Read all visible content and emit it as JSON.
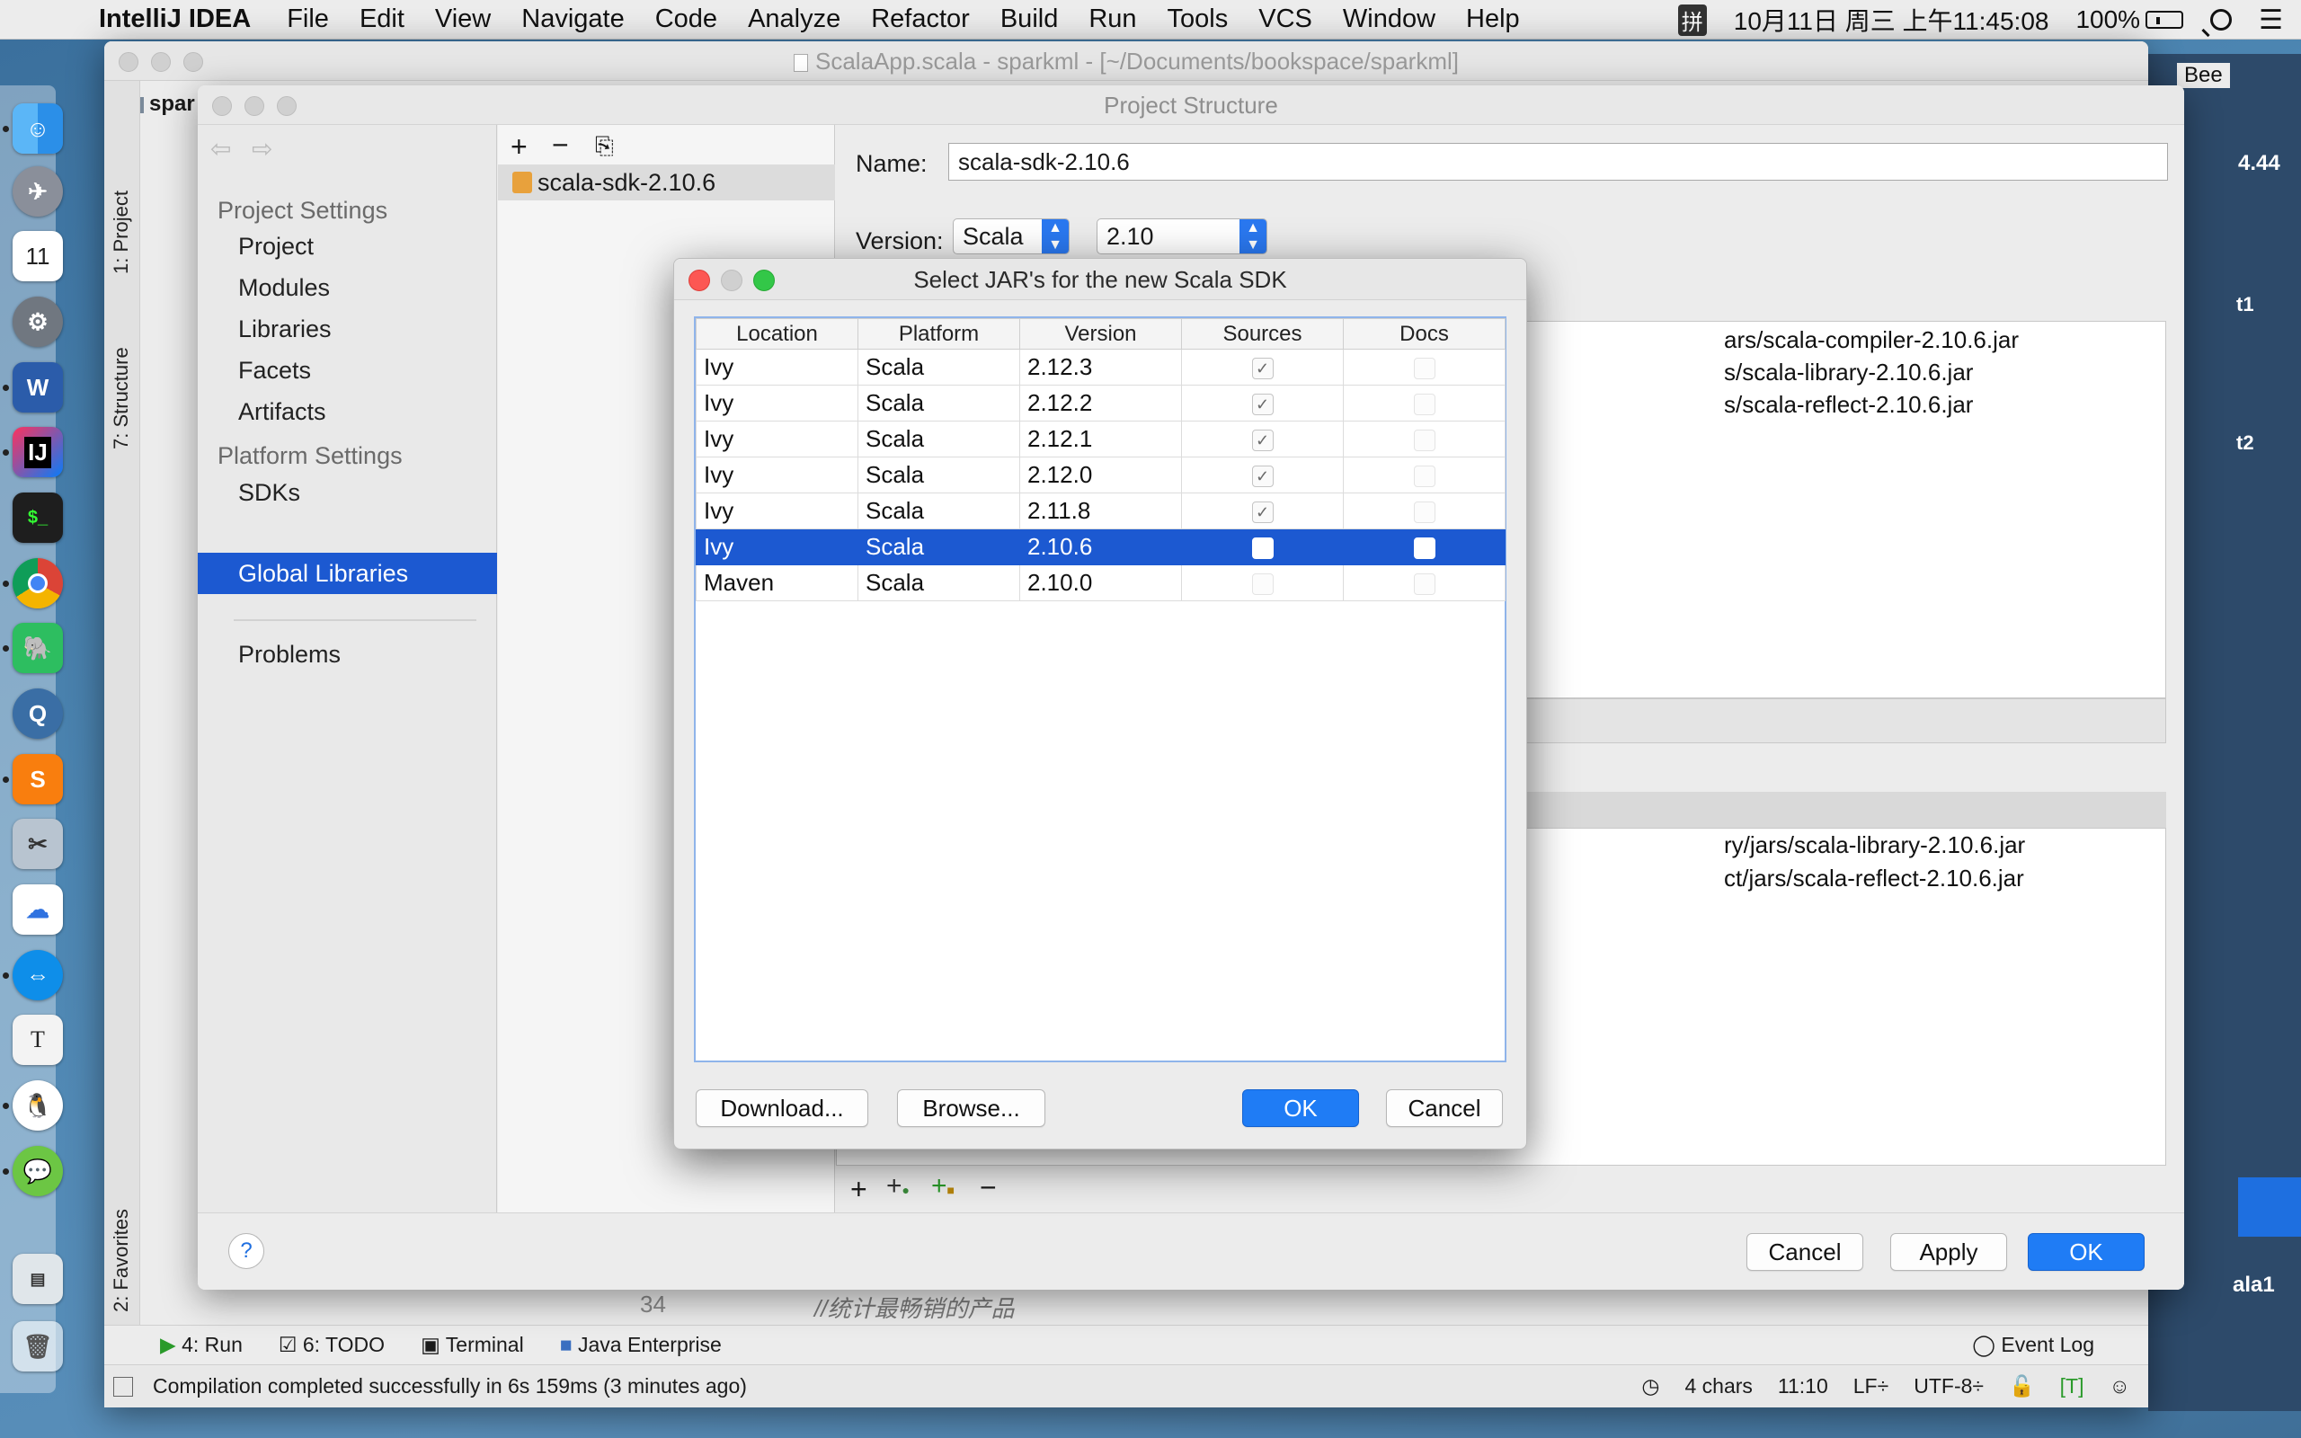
{
  "menubar": {
    "app_name": "IntelliJ IDEA",
    "menus": [
      "File",
      "Edit",
      "View",
      "Navigate",
      "Code",
      "Analyze",
      "Refactor",
      "Build",
      "Run",
      "Tools",
      "VCS",
      "Window",
      "Help"
    ],
    "input_method": "拼",
    "clock": "10月11日 周三 上午11:45:08",
    "battery": "100%"
  },
  "dock": {
    "items": [
      "finder-icon",
      "launchpad-icon",
      "calendar-icon",
      "system-preferences-icon",
      "word-icon",
      "intellij-icon",
      "terminal-icon",
      "chrome-icon",
      "evernote-icon",
      "quicktime-icon",
      "sublime-icon",
      "scissors-icon",
      "baidu-netdisk-icon",
      "teamviewer-icon",
      "typora-icon",
      "qq-icon",
      "wechat-icon",
      "preview-icon",
      "trash-icon"
    ],
    "calendar_day": "11",
    "intellij_label": "IJ",
    "typora_label": "T"
  },
  "ide": {
    "window_title": "ScalaApp.scala - sparkml - [~/Documents/bookspace/sparkml]",
    "project_crumb": "spar",
    "left_tabs": [
      "1: Project",
      "7: Structure",
      "2: Favorites"
    ],
    "code_line_number": "34",
    "code_line_text": "//统计最畅销的产品",
    "bottom_tabs": [
      "4: Run",
      "6: TODO",
      "Terminal",
      "Java Enterprise"
    ],
    "event_log": "Event Log",
    "status_message": "Compilation completed successfully in 6s 159ms (3 minutes ago)",
    "status_chars": "4 chars",
    "status_pos": "11:10",
    "status_lf": "LF÷",
    "status_encoding": "UTF-8÷",
    "status_ti": "[T]",
    "right_edge_labels": [
      "Bee",
      "4.44",
      "t1",
      "t2",
      "ala1"
    ]
  },
  "project_structure": {
    "title": "Project Structure",
    "project_settings_header": "Project Settings",
    "project_settings_items": [
      "Project",
      "Modules",
      "Libraries",
      "Facets",
      "Artifacts"
    ],
    "platform_settings_header": "Platform Settings",
    "platform_settings_items": [
      "SDKs",
      "Global Libraries"
    ],
    "problems": "Problems",
    "list_item": "scala-sdk-2.10.6",
    "name_label": "Name:",
    "name_value": "scala-sdk-2.10.6",
    "version_label": "Version:",
    "version_platform": "Scala",
    "version_number": "2.10",
    "compiler_jars": [
      "ars/scala-compiler-2.10.6.jar",
      "s/scala-library-2.10.6.jar",
      "s/scala-reflect-2.10.6.jar"
    ],
    "library_jars": [
      "ry/jars/scala-library-2.10.6.jar",
      "ct/jars/scala-reflect-2.10.6.jar"
    ],
    "cancel": "Cancel",
    "apply": "Apply",
    "ok": "OK",
    "help": "?"
  },
  "dialog": {
    "title": "Select JAR's for the new Scala SDK",
    "columns": [
      "Location",
      "Platform",
      "Version",
      "Sources",
      "Docs"
    ],
    "rows": [
      {
        "location": "Ivy",
        "platform": "Scala",
        "version": "2.12.3",
        "sources": true,
        "docs": false
      },
      {
        "location": "Ivy",
        "platform": "Scala",
        "version": "2.12.2",
        "sources": true,
        "docs": false
      },
      {
        "location": "Ivy",
        "platform": "Scala",
        "version": "2.12.1",
        "sources": true,
        "docs": false
      },
      {
        "location": "Ivy",
        "platform": "Scala",
        "version": "2.12.0",
        "sources": true,
        "docs": false
      },
      {
        "location": "Ivy",
        "platform": "Scala",
        "version": "2.11.8",
        "sources": true,
        "docs": false
      },
      {
        "location": "Ivy",
        "platform": "Scala",
        "version": "2.10.6",
        "sources": false,
        "docs": false,
        "selected": true
      },
      {
        "location": "Maven",
        "platform": "Scala",
        "version": "2.10.0",
        "sources": false,
        "docs": false
      }
    ],
    "download": "Download...",
    "browse": "Browse...",
    "ok": "OK",
    "cancel": "Cancel"
  },
  "colors": {
    "selection": "#1c59d1",
    "primary_button": "#1f7cf5",
    "close_red": "#fc5753",
    "min_yellow": "#fdbc40",
    "max_green": "#33c748"
  }
}
